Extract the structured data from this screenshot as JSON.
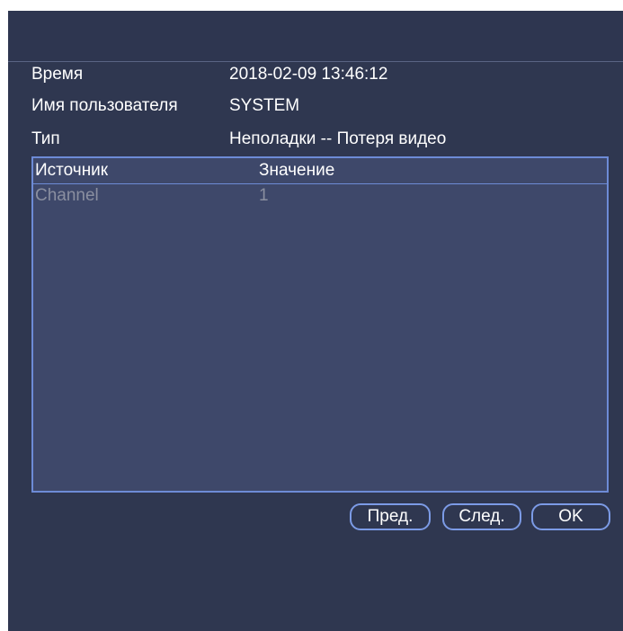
{
  "info": {
    "time_label": "Время",
    "time_value": "2018-02-09 13:46:12",
    "user_label": "Имя пользователя",
    "user_value": "SYSTEM",
    "type_label": "Тип",
    "type_value": "Неполадки -- Потеря видео"
  },
  "table": {
    "columns": [
      "Источник",
      "Значение"
    ],
    "rows": [
      {
        "source": "Channel",
        "value": "1"
      }
    ]
  },
  "buttons": {
    "prev_label": "Пред.",
    "next_label": "След.",
    "ok_label": "OK"
  },
  "colors": {
    "background": "#2f3750",
    "table_background": "#3e486a",
    "accent_border": "#6d8bd6",
    "disabled_text": "#8a8fa0"
  }
}
